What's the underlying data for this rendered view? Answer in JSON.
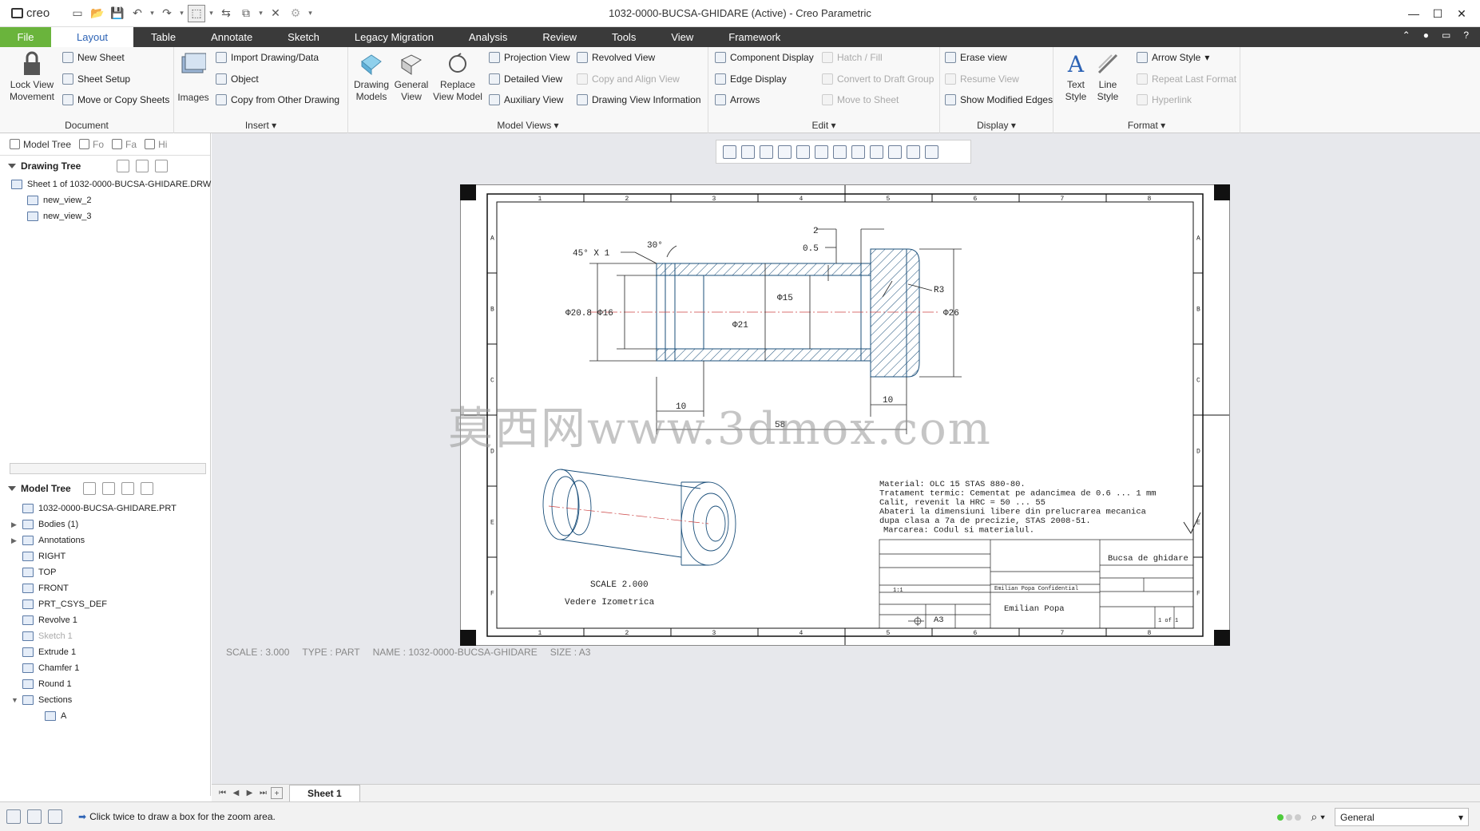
{
  "title": {
    "app_brand": "creo",
    "window_title": "1032-0000-BUCSA-GHIDARE (Active) - Creo Parametric"
  },
  "menu": [
    "File",
    "Layout",
    "Table",
    "Annotate",
    "Sketch",
    "Legacy Migration",
    "Analysis",
    "Review",
    "Tools",
    "View",
    "Framework"
  ],
  "ribbon": {
    "document": {
      "label": "Document",
      "lock_view_movement": "Lock View\nMovement",
      "new_sheet": "New Sheet",
      "sheet_setup": "Sheet Setup",
      "move_copy_sheets": "Move or Copy Sheets"
    },
    "insert": {
      "label": "Insert",
      "images": "Images",
      "import_data": "Import Drawing/Data",
      "object": "Object",
      "copy_from_other": "Copy from Other Drawing"
    },
    "model_views": {
      "label": "Model Views",
      "drawing_models": "Drawing\nModels",
      "general_view": "General\nView",
      "replace_view_model": "Replace\nView Model",
      "projection_view": "Projection View",
      "detailed_view": "Detailed View",
      "auxiliary_view": "Auxiliary View",
      "revolved_view": "Revolved View",
      "copy_align_view": "Copy and Align View",
      "drawing_view_info": "Drawing View Information"
    },
    "edit": {
      "label": "Edit",
      "component_display": "Component Display",
      "edge_display": "Edge Display",
      "arrows": "Arrows",
      "hatch_fill": "Hatch / Fill",
      "convert_draft_group": "Convert to Draft Group",
      "move_to_sheet": "Move to Sheet"
    },
    "display": {
      "label": "Display",
      "erase_view": "Erase view",
      "resume_view": "Resume View",
      "show_modified_edges": "Show Modified Edges"
    },
    "format": {
      "label": "Format",
      "text_style": "Text\nStyle",
      "line_style": "Line\nStyle",
      "arrow_style": "Arrow Style",
      "repeat_last_format": "Repeat Last Format",
      "hyperlink": "Hyperlink"
    }
  },
  "panel": {
    "tabs": [
      "Model Tree",
      "Fo",
      "Fa",
      "Hi"
    ],
    "drawing_tree_title": "Drawing Tree",
    "drawing_tree": [
      "Sheet 1 of 1032-0000-BUCSA-GHIDARE.DRW",
      "new_view_2",
      "new_view_3"
    ],
    "model_tree_title": "Model Tree",
    "model_tree": [
      {
        "label": "1032-0000-BUCSA-GHIDARE.PRT",
        "indent": 0
      },
      {
        "label": "Bodies (1)",
        "indent": 1,
        "expandable": true
      },
      {
        "label": "Annotations",
        "indent": 1,
        "expandable": true
      },
      {
        "label": "RIGHT",
        "indent": 1
      },
      {
        "label": "TOP",
        "indent": 1
      },
      {
        "label": "FRONT",
        "indent": 1
      },
      {
        "label": "PRT_CSYS_DEF",
        "indent": 1
      },
      {
        "label": "Revolve 1",
        "indent": 1
      },
      {
        "label": "Sketch 1",
        "indent": 1,
        "disabled": true
      },
      {
        "label": "Extrude 1",
        "indent": 1
      },
      {
        "label": "Chamfer 1",
        "indent": 1
      },
      {
        "label": "Round 1",
        "indent": 1
      },
      {
        "label": "Sections",
        "indent": 1,
        "expanded": true
      },
      {
        "label": "A",
        "indent": 2
      }
    ]
  },
  "drawing": {
    "border_cols": [
      "1",
      "2",
      "3",
      "4",
      "5",
      "6",
      "7",
      "8"
    ],
    "border_rows": [
      "A",
      "B",
      "C",
      "D",
      "E",
      "F"
    ],
    "dims": {
      "chamfer": "45° X 1",
      "angle": "30°",
      "d2": "2",
      "d05": "0.5",
      "r3": "R3",
      "phi208": "Φ20.8",
      "phi16": "Φ16",
      "phi15": "Φ15",
      "phi21": "Φ21",
      "phi26": "Φ26",
      "l10a": "10",
      "l10b": "10",
      "l58": "58"
    },
    "iso_scale": "SCALE 2.000",
    "iso_label": "Vedere Izometrica",
    "notes": [
      "Material: OLC 15 STAS 880-80.",
      "Tratament termic: Cementat pe adancimea de 0.6 ... 1 mm",
      "Calit, revenit la HRC = 50 ... 55",
      "Abateri la dimensiuni libere din prelucrarea mecanica",
      "dupa clasa a 7a de precizie, STAS 2008-51.",
      "Marcarea: Codul si materialul."
    ],
    "title_block": {
      "description": "Bucsa de ghidare",
      "author": "Emilian Popa",
      "sheet_size": "A3",
      "sheet": "1 of 1",
      "scale": "1:1",
      "confidential": "Emilian Popa Confidential"
    },
    "watermark": "莫西网www.3dmox.com"
  },
  "sheet_info": {
    "scale": "SCALE : 3.000",
    "type": "TYPE : PART",
    "name": "NAME : 1032-0000-BUCSA-GHIDARE",
    "size": "SIZE : A3"
  },
  "sheet_tab": "Sheet 1",
  "status": {
    "message": "Click twice to draw a box for the zoom area.",
    "filter": "General"
  }
}
